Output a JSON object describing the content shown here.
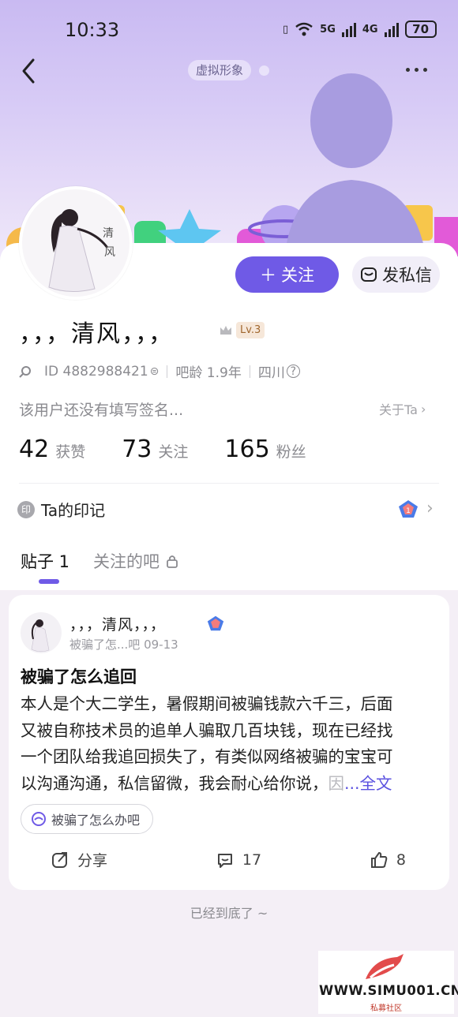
{
  "status_bar": {
    "time": "10:33",
    "network1": "5G",
    "network2": "4G",
    "battery": "70"
  },
  "header": {
    "virtual_avatar_label": "虚拟形象"
  },
  "profile": {
    "name": "，，，清风，，，",
    "level": "Lv.3",
    "id_label": "ID 4882988421",
    "tieba_age": "吧龄 1.9年",
    "location": "四川",
    "signature": "该用户还没有填写签名...",
    "about_link": "关于Ta"
  },
  "actions": {
    "follow": "关注",
    "message": "发私信"
  },
  "stats": [
    {
      "num": "42",
      "label": "获赞"
    },
    {
      "num": "73",
      "label": "关注"
    },
    {
      "num": "165",
      "label": "粉丝"
    }
  ],
  "seal": {
    "title": "Ta的印记",
    "icon_text": "印"
  },
  "tabs": {
    "posts": "贴子 1",
    "followed_bars": "关注的吧"
  },
  "post": {
    "user": "，，，清风，，，",
    "meta": "被骗了怎...吧  09-13",
    "title": "被骗了怎么追回",
    "lines": [
      "本人是个大二学生，暑假期间被骗钱款六千三，后面",
      "又被自称技术员的追单人骗取几百块钱，现在已经找",
      "一个团队给我追回损失了，有类似网络被骗的宝宝可",
      "以沟通沟通，私信留微，我会耐心给你说，"
    ],
    "faded_char": "因",
    "more": " ...全文",
    "tag": "被骗了怎么办吧",
    "share": "分享",
    "comments": "17",
    "likes": "8"
  },
  "footer": {
    "end_text": "已经到底了 ~"
  },
  "watermark": {
    "site": "WWW.SIMU001.CN",
    "subtitle": "私募社区"
  },
  "colors": {
    "accent": "#6f5ae6",
    "link": "#5b52e0"
  }
}
